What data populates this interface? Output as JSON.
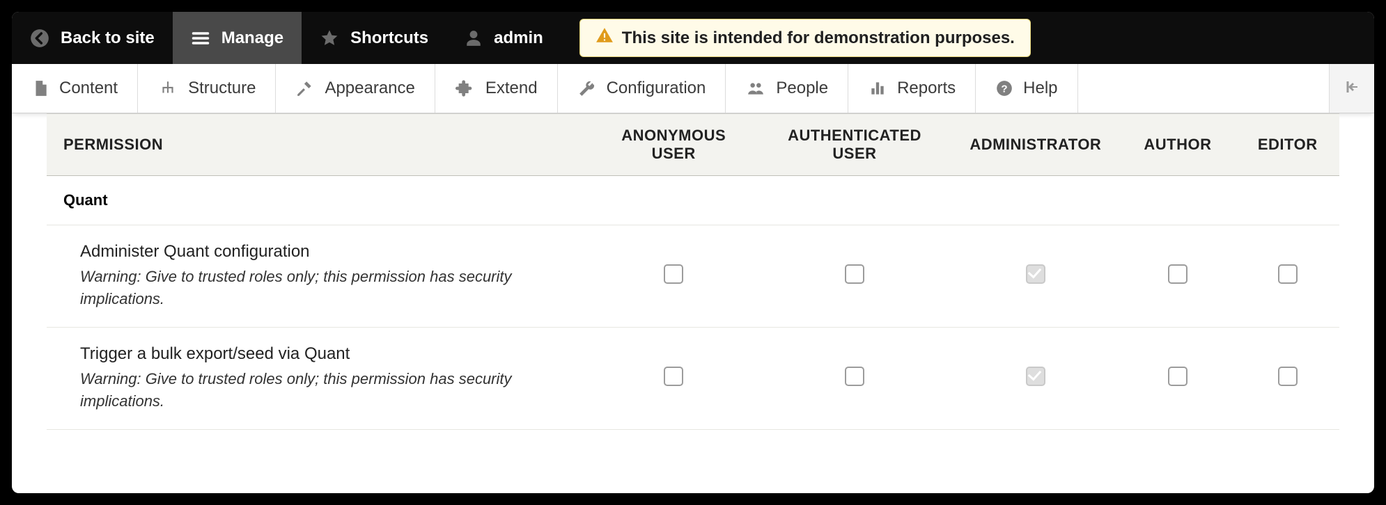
{
  "toolbar": {
    "back": "Back to site",
    "manage": "Manage",
    "shortcuts": "Shortcuts",
    "user": "admin",
    "demo_message": "This site is intended for demonstration purposes."
  },
  "admin_menu": [
    {
      "label": "Content"
    },
    {
      "label": "Structure"
    },
    {
      "label": "Appearance"
    },
    {
      "label": "Extend"
    },
    {
      "label": "Configuration"
    },
    {
      "label": "People"
    },
    {
      "label": "Reports"
    },
    {
      "label": "Help"
    }
  ],
  "permissions": {
    "columns": [
      "PERMISSION",
      "ANONYMOUS USER",
      "AUTHENTICATED USER",
      "ADMINISTRATOR",
      "AUTHOR",
      "EDITOR"
    ],
    "module": "Quant",
    "rows": [
      {
        "name": "Administer Quant configuration",
        "desc": "Warning: Give to trusted roles only; this permission has security implications.",
        "cells": {
          "anonymous": false,
          "authenticated": false,
          "administrator": "locked",
          "author": false,
          "editor": false
        }
      },
      {
        "name": "Trigger a bulk export/seed via Quant",
        "desc": "Warning: Give to trusted roles only; this permission has security implications.",
        "cells": {
          "anonymous": false,
          "authenticated": false,
          "administrator": "locked",
          "author": false,
          "editor": false
        }
      }
    ]
  }
}
